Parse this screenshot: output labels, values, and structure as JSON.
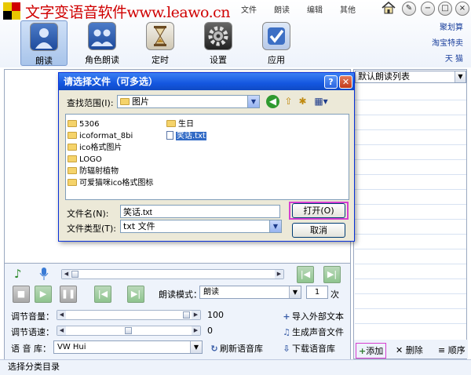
{
  "app": {
    "title": "文字变语音软件www.leawo.cn",
    "menu": [
      "文件",
      "朗读",
      "编辑",
      "其他"
    ],
    "side_links": [
      "聚划算",
      "淘宝特卖",
      "天 猫"
    ]
  },
  "toolbar": {
    "items": [
      {
        "label": "朗读",
        "icon": "person-icon"
      },
      {
        "label": "角色朗读",
        "icon": "people-icon"
      },
      {
        "label": "定时",
        "icon": "hourglass-icon"
      },
      {
        "label": "设置",
        "icon": "gear-icon"
      },
      {
        "label": "应用",
        "icon": "checkmark-icon"
      }
    ]
  },
  "controls": {
    "read_mode_label": "朗读模式：",
    "read_mode_value": "朗读",
    "count_value": "1",
    "count_unit": "次",
    "volume_label": "调节音量：",
    "volume_value": "100",
    "speed_label": "调节语速：",
    "speed_value": "0",
    "voice_lib_label": "语 音 库：",
    "voice_lib_value": "VW Hui",
    "refresh_label": "刷新语音库",
    "import_label": "导入外部文本",
    "generate_label": "生成声音文件",
    "download_label": "下载语音库"
  },
  "list_panel": {
    "combo_value": "默认朗读列表",
    "add_label": "添加",
    "delete_label": "删除",
    "order_label": "顺序"
  },
  "status": {
    "text": "选择分类目录"
  },
  "dialog": {
    "title": "请选择文件（可多选）",
    "look_in_label": "查找范围(I):",
    "look_in_value": "图片",
    "files": [
      {
        "name": "5306",
        "type": "folder"
      },
      {
        "name": "icoformat_8bi",
        "type": "folder"
      },
      {
        "name": "ico格式图片",
        "type": "folder"
      },
      {
        "name": "LOGO",
        "type": "folder"
      },
      {
        "name": "防辐射植物",
        "type": "folder"
      },
      {
        "name": "可爱猫咪ico格式图标",
        "type": "folder"
      },
      {
        "name": "生日",
        "type": "folder"
      },
      {
        "name": "笑话.txt",
        "type": "file"
      }
    ],
    "filename_label": "文件名(N):",
    "filename_value": "笑话.txt",
    "filetype_label": "文件类型(T):",
    "filetype_value": "txt 文件",
    "open_label": "打开(O)",
    "cancel_label": "取消"
  }
}
